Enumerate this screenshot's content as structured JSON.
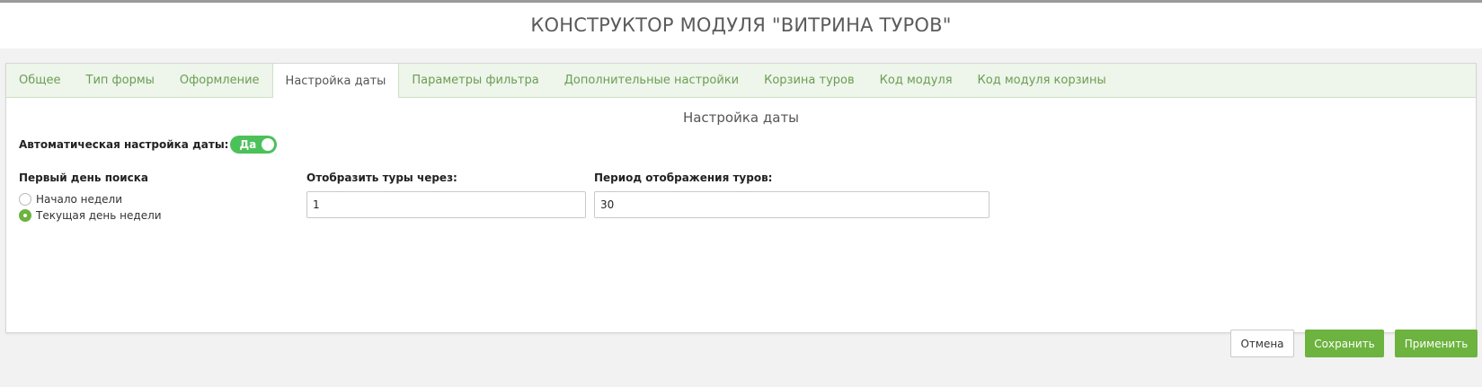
{
  "header": {
    "title": "КОНСТРУКТОР МОДУЛЯ \"ВИТРИНА ТУРОВ\""
  },
  "tabs": [
    {
      "label": "Общее",
      "active": false
    },
    {
      "label": "Тип формы",
      "active": false
    },
    {
      "label": "Оформление",
      "active": false
    },
    {
      "label": "Настройка даты",
      "active": true
    },
    {
      "label": "Параметры фильтра",
      "active": false
    },
    {
      "label": "Дополнительные настройки",
      "active": false
    },
    {
      "label": "Корзина туров",
      "active": false
    },
    {
      "label": "Код модуля",
      "active": false
    },
    {
      "label": "Код модуля корзины",
      "active": false
    }
  ],
  "section": {
    "title": "Настройка даты",
    "auto_label": "Автоматическая настройка даты:",
    "auto_toggle": {
      "label": "Да",
      "on": true
    },
    "first_day": {
      "label": "Первый день поиска",
      "options": [
        {
          "label": "Начало недели",
          "checked": false
        },
        {
          "label": "Текущая день недели",
          "checked": true
        }
      ]
    },
    "show_after": {
      "label": "Отобразить туры через:",
      "value": "1"
    },
    "display_period": {
      "label": "Период отображения туров:",
      "value": "30"
    }
  },
  "footer": {
    "cancel_label": "Отмена",
    "save_label": "Сохранить",
    "apply_label": "Применить"
  },
  "colors": {
    "accent": "#6db33f",
    "toggle": "#4cc15a",
    "tab_bar": "#eef5ea",
    "tab_text": "#6a9e55"
  }
}
